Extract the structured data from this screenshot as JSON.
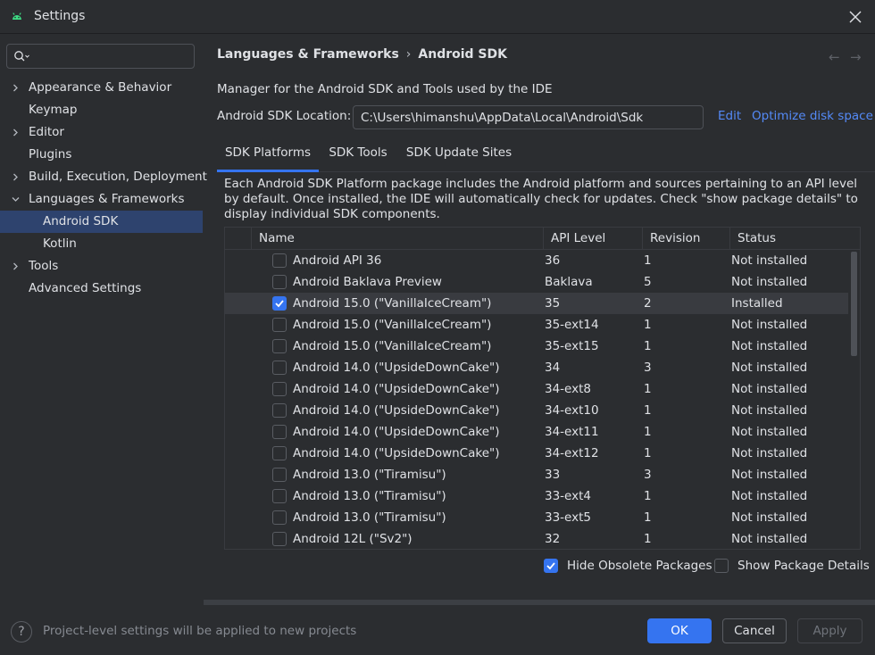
{
  "window": {
    "title": "Settings"
  },
  "search": {
    "placeholder": ""
  },
  "sidebar": {
    "items": [
      {
        "label": "Appearance & Behavior",
        "expandable": true,
        "expanded": false
      },
      {
        "label": "Keymap"
      },
      {
        "label": "Editor",
        "expandable": true,
        "expanded": false
      },
      {
        "label": "Plugins"
      },
      {
        "label": "Build, Execution, Deployment",
        "expandable": true,
        "expanded": false
      },
      {
        "label": "Languages & Frameworks",
        "expandable": true,
        "expanded": true
      },
      {
        "label": "Android SDK",
        "child": true,
        "selected": true
      },
      {
        "label": "Kotlin",
        "child": true
      },
      {
        "label": "Tools",
        "expandable": true,
        "expanded": false
      },
      {
        "label": "Advanced Settings"
      }
    ]
  },
  "breadcrumb": {
    "parent": "Languages & Frameworks",
    "separator": "›",
    "current": "Android SDK"
  },
  "nav_arrows": {
    "back": "←",
    "forward": "→"
  },
  "description": "Manager for the Android SDK and Tools used by the IDE",
  "location": {
    "label": "Android SDK Location:",
    "value": "C:\\Users\\himanshu\\AppData\\Local\\Android\\Sdk",
    "edit": "Edit",
    "optimize": "Optimize disk space"
  },
  "tabs": [
    {
      "label": "SDK Platforms",
      "active": true
    },
    {
      "label": "SDK Tools"
    },
    {
      "label": "SDK Update Sites"
    }
  ],
  "tab_description": "Each Android SDK Platform package includes the Android platform and sources pertaining to an API level by default. Once installed, the IDE will automatically check for updates. Check \"show package details\" to display individual SDK components.",
  "table": {
    "columns": [
      "Name",
      "API Level",
      "Revision",
      "Status"
    ],
    "rows": [
      {
        "name": "Android API 36",
        "api": "36",
        "rev": "1",
        "status": "Not installed",
        "checked": false
      },
      {
        "name": "Android Baklava Preview",
        "api": "Baklava",
        "rev": "5",
        "status": "Not installed",
        "checked": false
      },
      {
        "name": "Android 15.0 (\"VanillaIceCream\")",
        "api": "35",
        "rev": "2",
        "status": "Installed",
        "checked": true,
        "selected": true
      },
      {
        "name": "Android 15.0 (\"VanillaIceCream\")",
        "api": "35-ext14",
        "rev": "1",
        "status": "Not installed",
        "checked": false
      },
      {
        "name": "Android 15.0 (\"VanillaIceCream\")",
        "api": "35-ext15",
        "rev": "1",
        "status": "Not installed",
        "checked": false
      },
      {
        "name": "Android 14.0 (\"UpsideDownCake\")",
        "api": "34",
        "rev": "3",
        "status": "Not installed",
        "checked": false
      },
      {
        "name": "Android 14.0 (\"UpsideDownCake\")",
        "api": "34-ext8",
        "rev": "1",
        "status": "Not installed",
        "checked": false
      },
      {
        "name": "Android 14.0 (\"UpsideDownCake\")",
        "api": "34-ext10",
        "rev": "1",
        "status": "Not installed",
        "checked": false
      },
      {
        "name": "Android 14.0 (\"UpsideDownCake\")",
        "api": "34-ext11",
        "rev": "1",
        "status": "Not installed",
        "checked": false
      },
      {
        "name": "Android 14.0 (\"UpsideDownCake\")",
        "api": "34-ext12",
        "rev": "1",
        "status": "Not installed",
        "checked": false
      },
      {
        "name": "Android 13.0 (\"Tiramisu\")",
        "api": "33",
        "rev": "3",
        "status": "Not installed",
        "checked": false
      },
      {
        "name": "Android 13.0 (\"Tiramisu\")",
        "api": "33-ext4",
        "rev": "1",
        "status": "Not installed",
        "checked": false
      },
      {
        "name": "Android 13.0 (\"Tiramisu\")",
        "api": "33-ext5",
        "rev": "1",
        "status": "Not installed",
        "checked": false
      },
      {
        "name": "Android 12L (\"Sv2\")",
        "api": "32",
        "rev": "1",
        "status": "Not installed",
        "checked": false
      }
    ]
  },
  "options": {
    "hide_obsolete": {
      "label": "Hide Obsolete Packages",
      "checked": true
    },
    "show_details": {
      "label": "Show Package Details",
      "checked": false
    }
  },
  "footer": {
    "help": "?",
    "note": "Project-level settings will be applied to new projects",
    "ok": "OK",
    "cancel": "Cancel",
    "apply": "Apply"
  },
  "colors": {
    "accent": "#3574f0",
    "link": "#548af7",
    "selection": "#2e436e",
    "android_green": "#3ddc84"
  }
}
